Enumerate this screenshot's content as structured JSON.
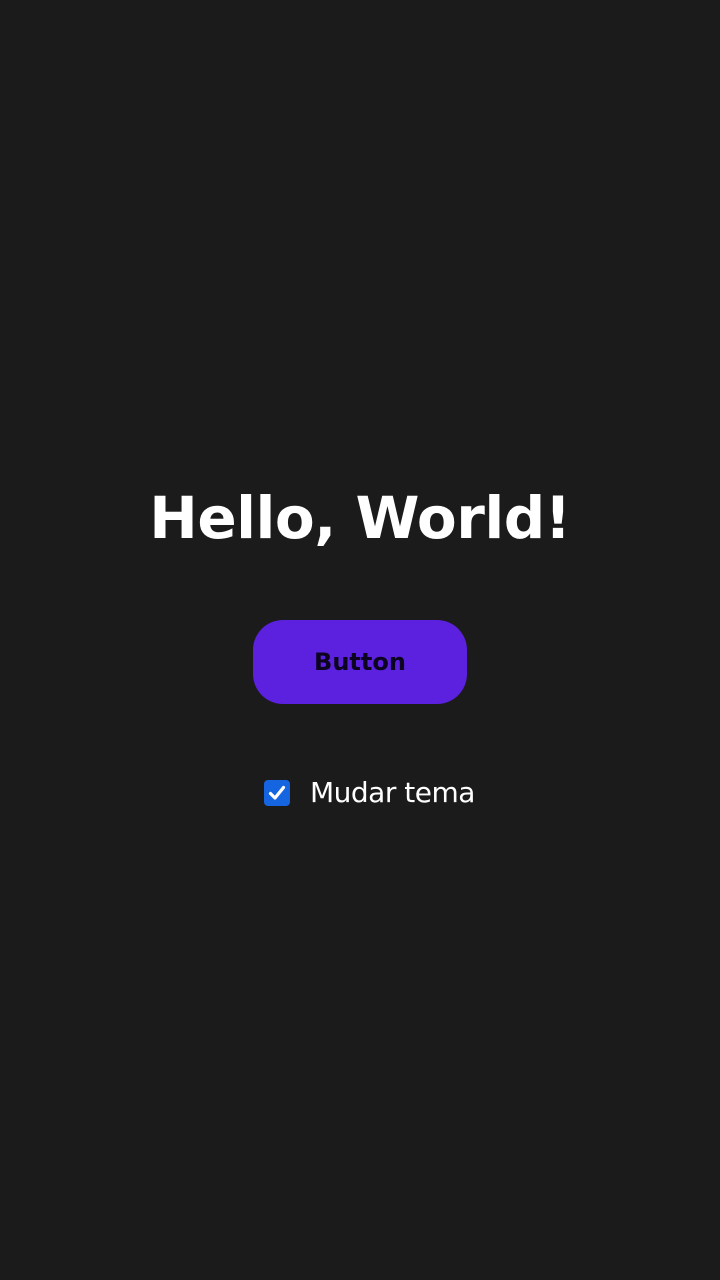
{
  "app": {
    "title": "Hello, World!",
    "accent_color": "#5b21de",
    "background_color": "#1b1b1b"
  },
  "main_button": {
    "label": "Button"
  },
  "theme_toggle": {
    "label": "Mudar tema",
    "checked": true,
    "checkbox_color": "#1565e0",
    "icon": "checkmark-icon"
  }
}
